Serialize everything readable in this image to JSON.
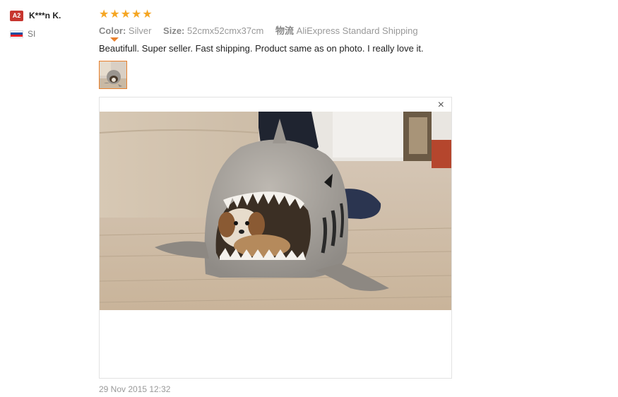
{
  "user": {
    "level_badge": "A2",
    "name": "K***n K.",
    "country_code": "SI"
  },
  "review": {
    "stars": [
      "★",
      "★",
      "★",
      "★",
      "★"
    ],
    "rating": 5,
    "color_label": "Color:",
    "color_value": "Silver",
    "size_label": "Size:",
    "size_value": "52cmx52cmx37cm",
    "shipping_label": "物流",
    "shipping_value": "AliExpress Standard Shipping",
    "text": "Beautifull. Super seller. Fast shipping. Product same as on photo. I really love it.",
    "date": "29 Nov 2015 12:32"
  },
  "photo_viewer": {
    "close_glyph": "×"
  },
  "colors": {
    "badge": "#c7362f",
    "star": "#f5a623",
    "thumb_border": "#e8802c"
  }
}
